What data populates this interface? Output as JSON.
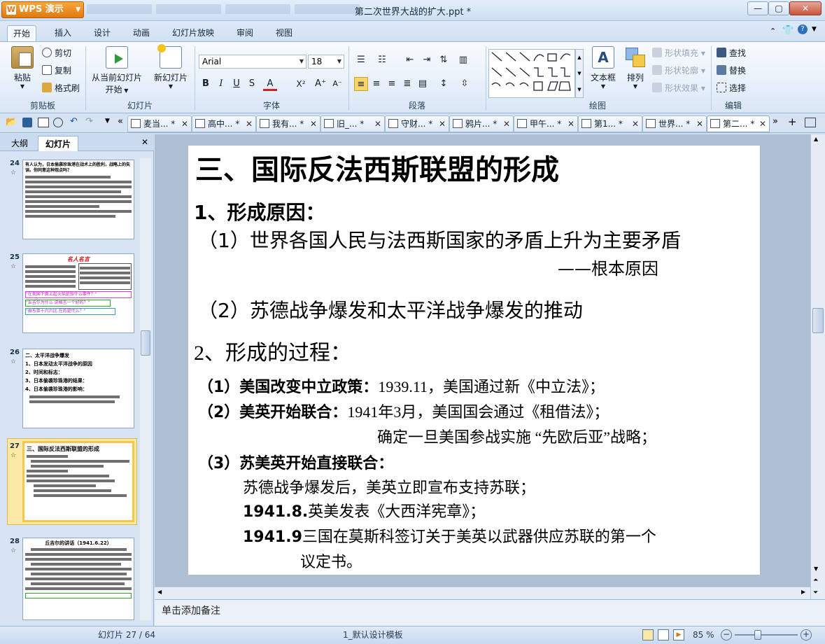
{
  "app": {
    "name": "WPS 演示",
    "document_title": "第二次世界大战的扩大.ppt *"
  },
  "menu": {
    "tabs": [
      "开始",
      "插入",
      "设计",
      "动画",
      "幻灯片放映",
      "审阅",
      "视图"
    ]
  },
  "ribbon": {
    "clipboard": {
      "paste": "粘贴",
      "cut": "剪切",
      "copy": "复制",
      "format_painter": "格式刷",
      "label": "剪贴板"
    },
    "slides": {
      "from_current": "从当前幻灯片",
      "start": "开始",
      "new_slide": "新幻灯片",
      "label": "幻灯片"
    },
    "font": {
      "name": "Arial",
      "size": "18",
      "label": "字体"
    },
    "paragraph": {
      "label": "段落"
    },
    "drawing": {
      "textbox": "文本框",
      "arrange": "排列",
      "shape_fill": "形状填充",
      "shape_outline": "形状轮廓",
      "shape_effects": "形状效果",
      "label": "绘图"
    },
    "editing": {
      "find": "查找",
      "replace": "替换",
      "select": "选择",
      "label": "编辑"
    }
  },
  "doc_tabs": [
    "麦当...",
    "高中...",
    "我有...",
    "旧_...",
    "守财...",
    "鸦片...",
    "甲午...",
    "第1...",
    "世界...",
    "第二..."
  ],
  "left_pane": {
    "tabs": [
      "大纲",
      "幻灯片"
    ],
    "thumbnails": [
      {
        "num": "24",
        "title": "有人认为，日本偷袭珍珠港在战术上的胜利，战略上的失误。你同意这种观点吗？"
      },
      {
        "num": "25",
        "title": "名人名言"
      },
      {
        "num": "26",
        "title": "二、太平洋战争爆发"
      },
      {
        "num": "27",
        "title": "三、国际反法西斯联盟的形成"
      },
      {
        "num": "28",
        "title": "丘吉尔的讲话（1941.6.22）"
      }
    ],
    "thumb26_lines": [
      "1、日本发动太平洋战争的原因",
      "2、时间和标志：",
      "3、日本偷袭珍珠港的结果：",
      "4、日本偷袭珍珠港的影响："
    ],
    "thumb25_q": [
      "\"在美国下面上起火焰是指什么事件？\"",
      "\"丘吉尔为什么 说格言一个好的？\"",
      "\"由东亚十六六比 在的是什么？\""
    ]
  },
  "slide": {
    "title": "三、国际反法西斯联盟的形成",
    "h1": "1、形成原因：",
    "r1": "（1）世界各国人民与法西斯国家的矛盾上升为主要矛盾",
    "r1b": "——根本原因",
    "r2": "（2）苏德战争爆发和太平洋战争爆发的推动",
    "h2": "2、形成的过程：",
    "p1a": "（1）美国改变中立政策：",
    "p1b": "1939.11，美国通过新《中立法》；",
    "p2a": "（2）美英开始联合：",
    "p2b": "1941年3月，美国国会通过《租借法》；",
    "p2c": "确定一旦美国参战实施 “先欧后亚”战略；",
    "p3a": "（3）苏美英开始直接联合：",
    "p3b": "苏德战争爆发后，美英立即宣布支持苏联；",
    "p3c_bold": "1941.8.",
    "p3c": "英美发表《大西洋宪章》；",
    "p3d_bold": "1941.9",
    "p3d": "三国在莫斯科签订关于美英以武器供应苏联的第一个",
    "p3e": "议定书。"
  },
  "notes": {
    "placeholder": "单击添加备注"
  },
  "status": {
    "slide_count": "幻灯片 27 / 64",
    "template": "1_默认设计模板",
    "zoom": "85 %"
  }
}
